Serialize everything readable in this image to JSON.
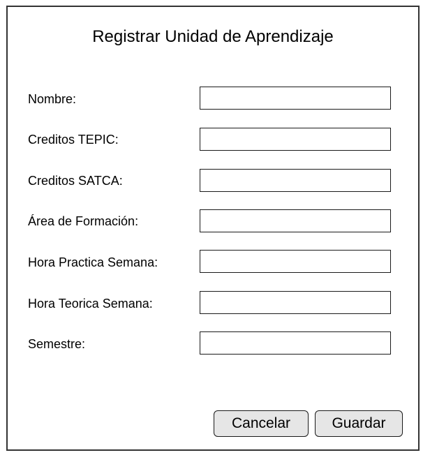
{
  "form": {
    "title": "Registrar Unidad de Aprendizaje",
    "fields": [
      {
        "label": "Nombre:",
        "value": ""
      },
      {
        "label": "Creditos TEPIC:",
        "value": ""
      },
      {
        "label": "Creditos SATCA:",
        "value": ""
      },
      {
        "label": "Área de Formación:",
        "value": ""
      },
      {
        "label": "Hora Practica Semana:",
        "value": ""
      },
      {
        "label": "Hora Teorica Semana:",
        "value": ""
      },
      {
        "label": "Semestre:",
        "value": ""
      }
    ],
    "cancel_label": "Cancelar",
    "save_label": "Guardar"
  }
}
